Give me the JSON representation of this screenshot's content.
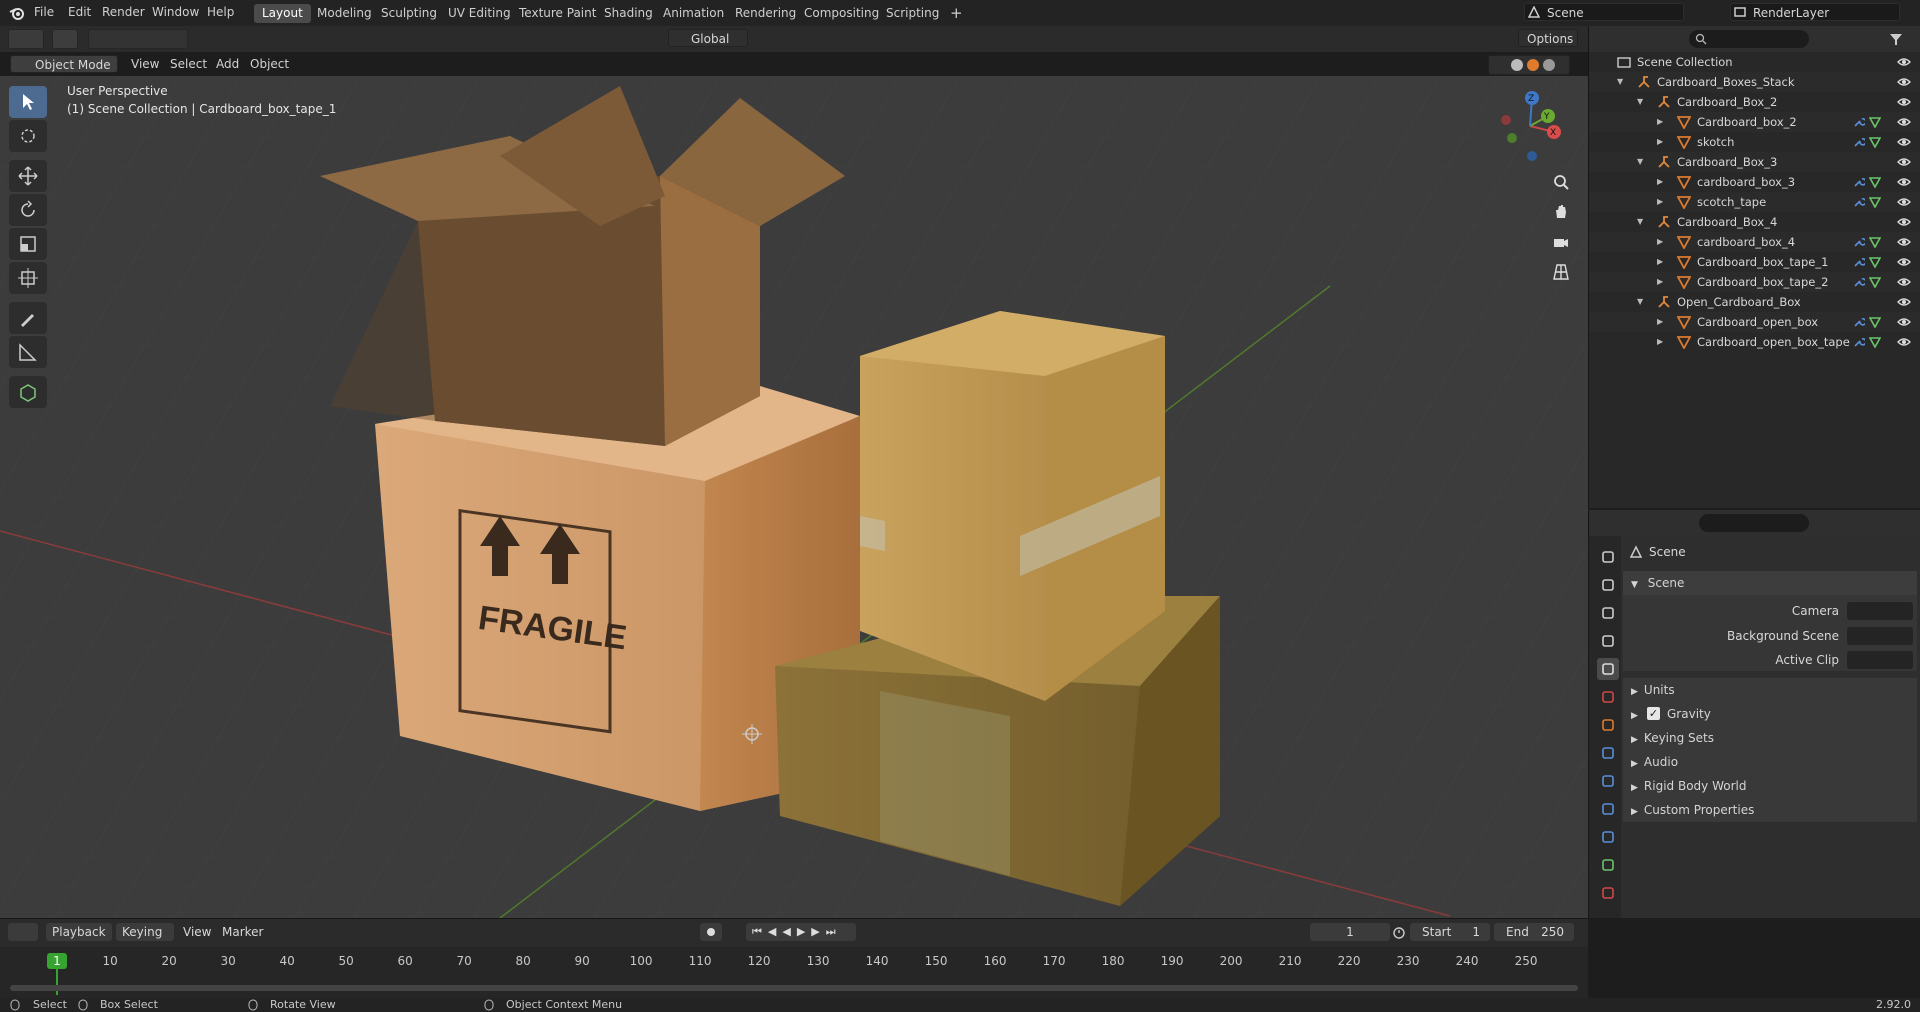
{
  "menu": {
    "file": "File",
    "edit": "Edit",
    "render": "Render",
    "window": "Window",
    "help": "Help"
  },
  "workspaces": [
    "Layout",
    "Modeling",
    "Sculpting",
    "UV Editing",
    "Texture Paint",
    "Shading",
    "Animation",
    "Rendering",
    "Compositing",
    "Scripting"
  ],
  "active_workspace": "Layout",
  "scene_name": "Scene",
  "render_layer": "RenderLayer",
  "viewport_header": {
    "mode": "Object Mode",
    "view": "View",
    "select": "Select",
    "add": "Add",
    "object": "Object",
    "orientation": "Global",
    "options": "Options"
  },
  "viewport": {
    "perspective": "User Perspective",
    "context": "(1) Scene Collection | Cardboard_box_tape_1",
    "box_label": "FRAGILE"
  },
  "gizmo": {
    "x": "X",
    "y": "Y",
    "z": "Z"
  },
  "outliner": {
    "root": "Scene Collection",
    "rows": [
      {
        "label": "Cardboard_Boxes_Stack"
      },
      {
        "label": "Cardboard_Box_2"
      },
      {
        "label": "Cardboard_box_2"
      },
      {
        "label": "skotch"
      },
      {
        "label": "Cardboard_Box_3"
      },
      {
        "label": "cardboard_box_3"
      },
      {
        "label": "scotch_tape"
      },
      {
        "label": "Cardboard_Box_4"
      },
      {
        "label": "cardboard_box_4"
      },
      {
        "label": "Cardboard_box_tape_1"
      },
      {
        "label": "Cardboard_box_tape_2"
      },
      {
        "label": "Open_Cardboard_Box"
      },
      {
        "label": "Cardboard_open_box"
      },
      {
        "label": "Cardboard_open_box_tape"
      }
    ]
  },
  "properties": {
    "breadcrumb": "Scene",
    "panel": "Scene",
    "camera_label": "Camera",
    "background_label": "Background Scene",
    "clip_label": "Active Clip",
    "sections": [
      "Units",
      "Gravity",
      "Keying Sets",
      "Audio",
      "Rigid Body World",
      "Custom Properties"
    ],
    "gravity_checked": true
  },
  "timeline": {
    "playback": "Playback",
    "keying": "Keying",
    "view": "View",
    "marker": "Marker",
    "current_frame": "1",
    "start_label": "Start",
    "start": "1",
    "end_label": "End",
    "end": "250",
    "ticks": [
      "1",
      "10",
      "20",
      "30",
      "40",
      "50",
      "60",
      "70",
      "80",
      "90",
      "100",
      "110",
      "120",
      "130",
      "140",
      "150",
      "160",
      "170",
      "180",
      "190",
      "200",
      "210",
      "220",
      "230",
      "240",
      "250"
    ]
  },
  "statusbar": {
    "select": "Select",
    "box_select": "Box Select",
    "rotate": "Rotate View",
    "context_menu": "Object Context Menu",
    "version": "2.92.0"
  },
  "colors": {
    "accent": "#4d6a90",
    "collection_icon": "#e08a3c",
    "mesh_icon": "#e07a2c",
    "frame_green": "#37a432"
  }
}
